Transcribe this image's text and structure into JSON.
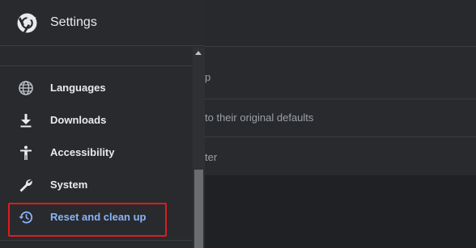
{
  "header": {
    "title": "Settings"
  },
  "menu": {
    "items": [
      {
        "label": "Languages",
        "icon": "globe-icon"
      },
      {
        "label": "Downloads",
        "icon": "download-icon"
      },
      {
        "label": "Accessibility",
        "icon": "accessibility-icon"
      },
      {
        "label": "System",
        "icon": "wrench-icon"
      },
      {
        "label": "Reset and clean up",
        "icon": "history-icon",
        "active": true
      }
    ]
  },
  "main": {
    "row1_text": "p",
    "row2_text": "to their original defaults",
    "row3_text": "ter"
  },
  "colors": {
    "accent": "#8ab4f8",
    "highlight": "#e11b1b",
    "background": "#202124",
    "sidebar": "#292a2d"
  }
}
